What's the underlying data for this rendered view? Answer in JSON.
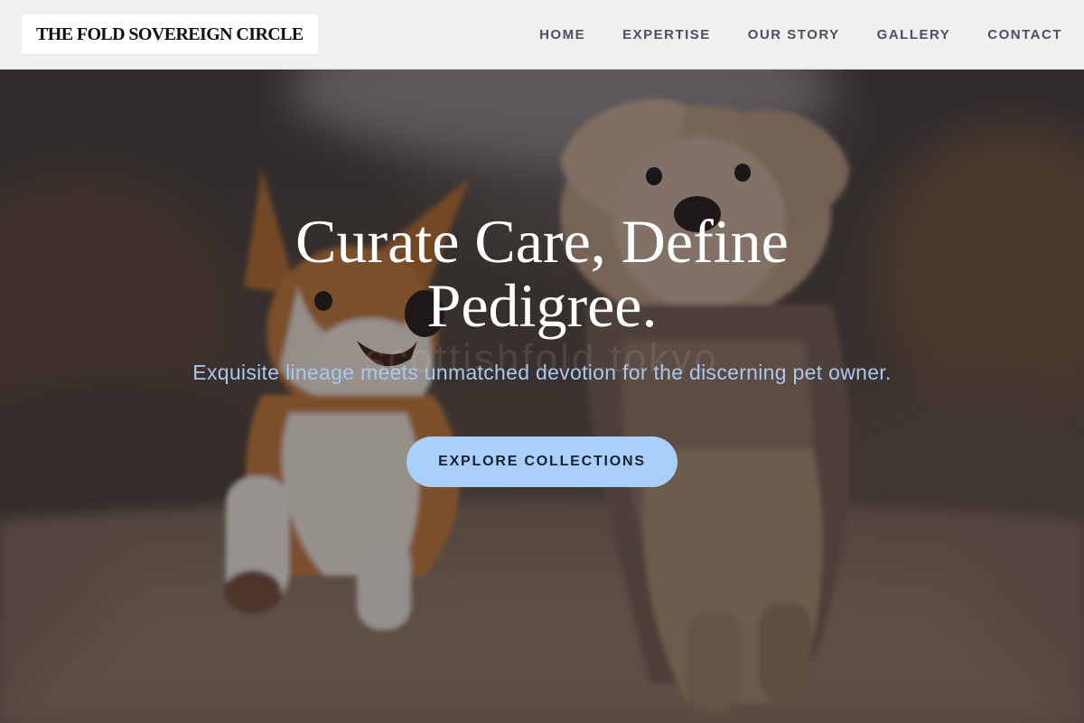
{
  "brand": {
    "name": "THE FOLD SOVEREIGN CIRCLE"
  },
  "nav": {
    "items": [
      {
        "label": "HOME"
      },
      {
        "label": "EXPERTISE"
      },
      {
        "label": "OUR STORY"
      },
      {
        "label": "GALLERY"
      },
      {
        "label": "CONTACT"
      }
    ]
  },
  "hero": {
    "title": "Curate Care, Define Pedigree.",
    "subtitle": "Exquisite lineage meets unmatched devotion for the discerning pet owner.",
    "watermark": "scottishfold.tokyo",
    "cta_label": "EXPLORE COLLECTIONS"
  },
  "colors": {
    "header_bg": "#f0f0f1",
    "nav_text": "#4a5160",
    "hero_title": "#ffffff",
    "hero_subtitle": "#a9c8f0",
    "cta_bg": "#a8d0fb",
    "cta_text": "#18222e"
  }
}
